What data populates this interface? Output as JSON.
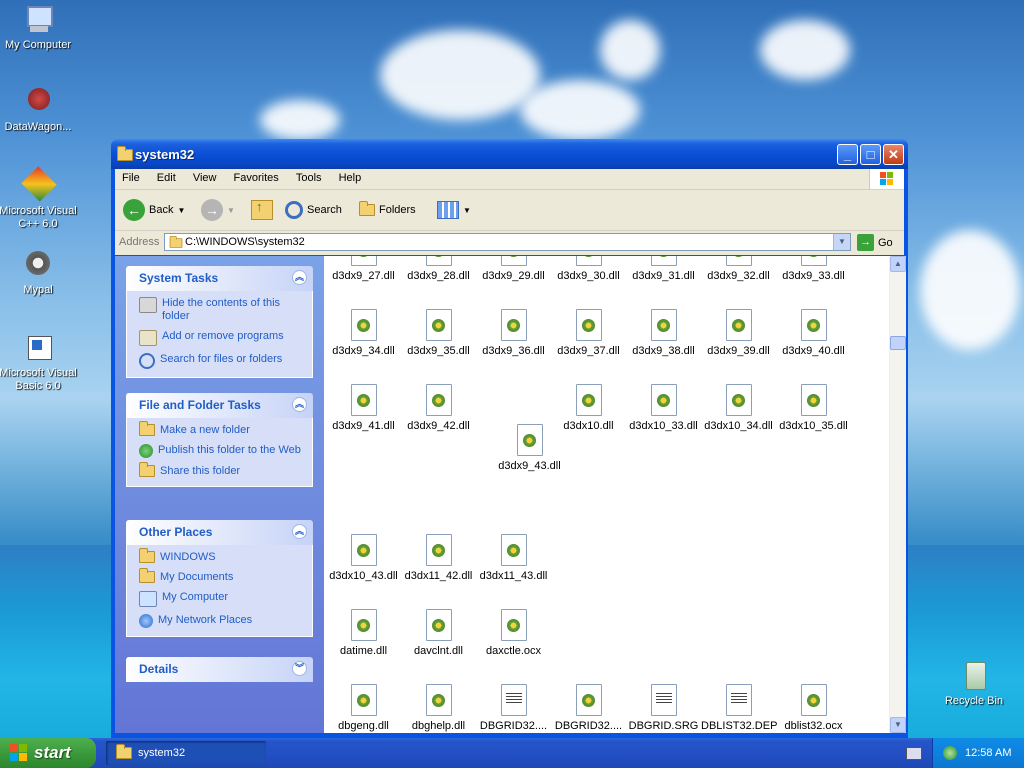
{
  "desktop": {
    "icons": [
      {
        "label": "My Computer"
      },
      {
        "label": "DataWagon..."
      },
      {
        "label": "Microsoft Visual C++ 6.0"
      },
      {
        "label": "Mypal"
      },
      {
        "label": "Microsoft Visual Basic 6.0"
      },
      {
        "label": "Recycle Bin"
      }
    ]
  },
  "window": {
    "title": "system32",
    "menu": [
      "File",
      "Edit",
      "View",
      "Favorites",
      "Tools",
      "Help"
    ],
    "toolbar": {
      "back": "Back",
      "search": "Search",
      "folders": "Folders"
    },
    "address": {
      "label": "Address",
      "value": "C:\\WINDOWS\\system32",
      "go": "Go"
    }
  },
  "tasks": {
    "system": {
      "title": "System Tasks",
      "items": [
        "Hide the contents of this folder",
        "Add or remove programs",
        "Search for files or folders"
      ]
    },
    "file_folder": {
      "title": "File and Folder Tasks",
      "items": [
        "Make a new folder",
        "Publish this folder to the Web",
        "Share this folder"
      ]
    },
    "other": {
      "title": "Other Places",
      "items": [
        "WINDOWS",
        "My Documents",
        "My Computer",
        "My Network Places"
      ]
    },
    "details": {
      "title": "Details"
    }
  },
  "files": [
    "d3dx9_27.dll",
    "d3dx9_28.dll",
    "d3dx9_29.dll",
    "d3dx9_30.dll",
    "d3dx9_31.dll",
    "d3dx9_32.dll",
    "d3dx9_33.dll",
    "d3dx9_34.dll",
    "d3dx9_35.dll",
    "d3dx9_36.dll",
    "d3dx9_37.dll",
    "d3dx9_38.dll",
    "d3dx9_39.dll",
    "d3dx9_40.dll",
    "d3dx9_41.dll",
    "d3dx9_42.dll",
    "d3dx10.dll",
    "d3dx10_33.dll",
    "d3dx10_34.dll",
    "d3dx10_35.dll",
    "d3dx9_43.dll",
    "d3dx10_43.dll",
    "d3dx11_42.dll",
    "d3dx11_43.dll",
    "datime.dll",
    "davclnt.dll",
    "daxctle.ocx",
    "dbgeng.dll",
    "dbghelp.dll",
    "DBGRID32....",
    "DBGRID32....",
    "DBGRID.SRG",
    "DBLIST32.DEP",
    "dblist32.ocx"
  ],
  "taskbar": {
    "start": "start",
    "active_task": "system32",
    "clock": "12:58 AM"
  }
}
